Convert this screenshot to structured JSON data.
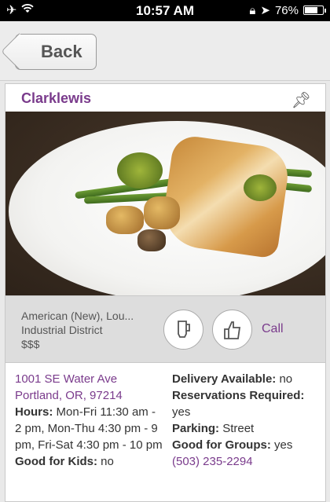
{
  "status_bar": {
    "signal": "✈",
    "wifi": "wifi",
    "time": "10:57 AM",
    "battery": "76%",
    "battery_level": 0.76
  },
  "nav": {
    "back_label": "Back"
  },
  "restaurant": {
    "name": "Clarklewis",
    "category": "American (New), Lou...",
    "neighborhood": "Industrial District",
    "price": "$$$",
    "call_label": "Call",
    "address_line1": "1001 SE Water Ave",
    "address_line2": "Portland, OR, 97214",
    "hours_label": "Hours:",
    "hours_value": "Mon-Fri 11:30 am - 2 pm, Mon-Thu 4:30 pm - 9 pm, Fri-Sat 4:30 pm - 10 pm",
    "kids_label": "Good for Kids:",
    "kids_value": "no",
    "delivery_label": "Delivery Available:",
    "delivery_value": "no",
    "reservations_label": "Reservations Required:",
    "reservations_value": "yes",
    "parking_label": "Parking:",
    "parking_value": "Street",
    "groups_label": "Good for Groups:",
    "groups_value": "yes",
    "phone": "(503) 235-2294"
  },
  "colors": {
    "accent": "#7a3b8c"
  }
}
